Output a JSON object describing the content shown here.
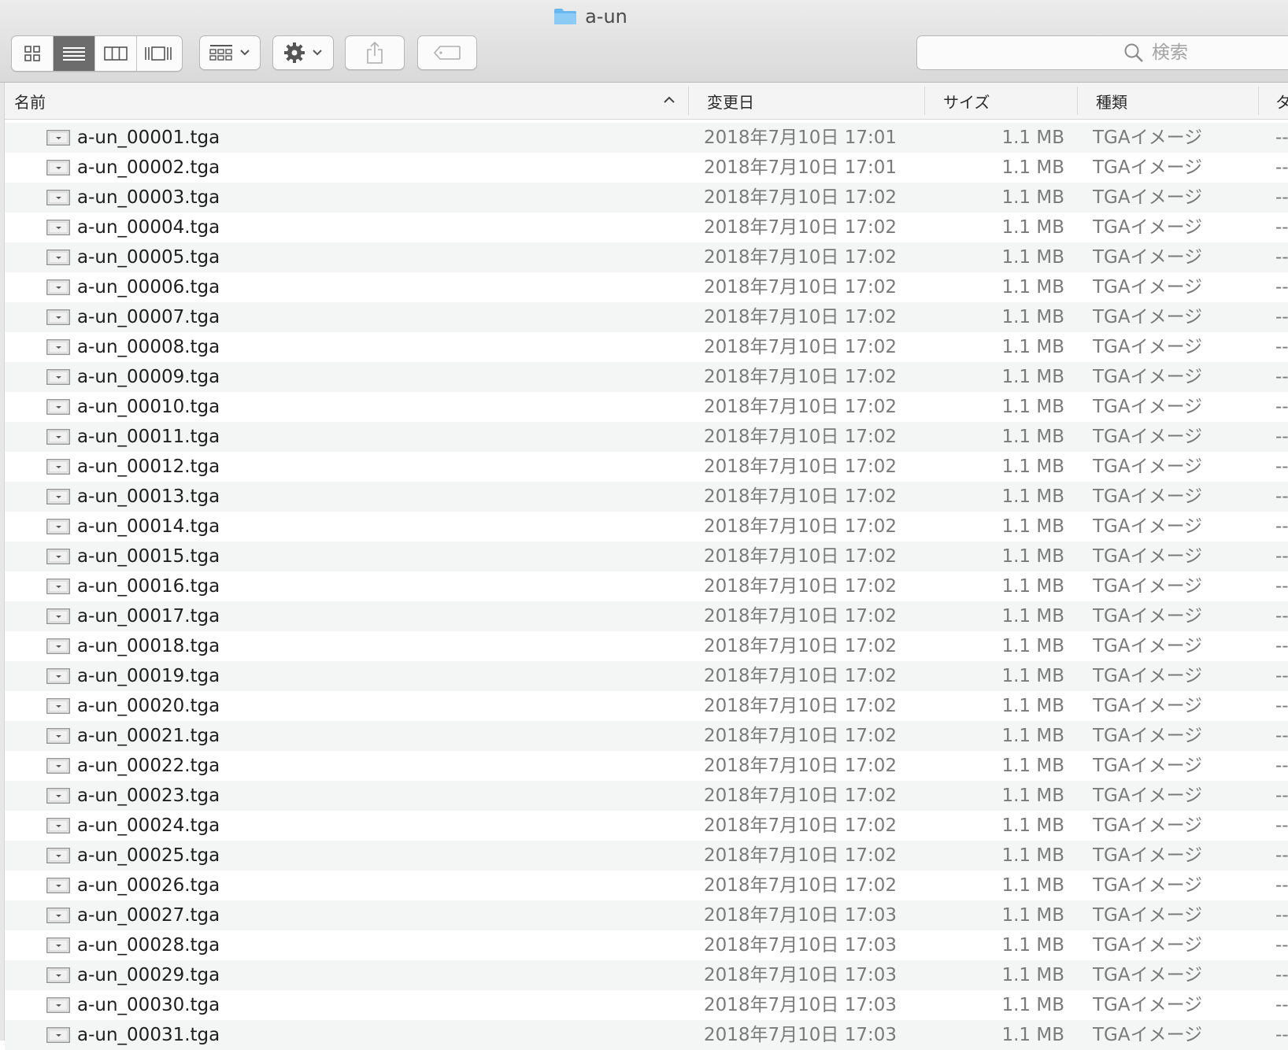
{
  "window": {
    "title": "a-un",
    "folder_icon": "folder-icon",
    "folder_color": "#6ab7ef"
  },
  "toolbar": {
    "view_modes": [
      {
        "name": "icon-view",
        "icon": "grid-icon",
        "active": false
      },
      {
        "name": "list-view",
        "icon": "list-icon",
        "active": true
      },
      {
        "name": "column-view",
        "icon": "columns-icon",
        "active": false
      },
      {
        "name": "cover-flow-view",
        "icon": "cover-flow-icon",
        "active": false
      }
    ],
    "group_icon": "group-icon",
    "action_icon": "gear-icon",
    "share_icon": "share-icon",
    "tag_icon": "tag-icon"
  },
  "search": {
    "placeholder": "検索",
    "value": ""
  },
  "columns": {
    "name": "名前",
    "date": "変更日",
    "size": "サイズ",
    "kind": "種類",
    "tag": "タ"
  },
  "files": [
    {
      "name": "a-un_00001.tga",
      "date": "2018年7月10日 17:01",
      "size": "1.1 MB",
      "kind": "TGAイメージ",
      "tag": "--"
    },
    {
      "name": "a-un_00002.tga",
      "date": "2018年7月10日 17:01",
      "size": "1.1 MB",
      "kind": "TGAイメージ",
      "tag": "--"
    },
    {
      "name": "a-un_00003.tga",
      "date": "2018年7月10日 17:02",
      "size": "1.1 MB",
      "kind": "TGAイメージ",
      "tag": "--"
    },
    {
      "name": "a-un_00004.tga",
      "date": "2018年7月10日 17:02",
      "size": "1.1 MB",
      "kind": "TGAイメージ",
      "tag": "--"
    },
    {
      "name": "a-un_00005.tga",
      "date": "2018年7月10日 17:02",
      "size": "1.1 MB",
      "kind": "TGAイメージ",
      "tag": "--"
    },
    {
      "name": "a-un_00006.tga",
      "date": "2018年7月10日 17:02",
      "size": "1.1 MB",
      "kind": "TGAイメージ",
      "tag": "--"
    },
    {
      "name": "a-un_00007.tga",
      "date": "2018年7月10日 17:02",
      "size": "1.1 MB",
      "kind": "TGAイメージ",
      "tag": "--"
    },
    {
      "name": "a-un_00008.tga",
      "date": "2018年7月10日 17:02",
      "size": "1.1 MB",
      "kind": "TGAイメージ",
      "tag": "--"
    },
    {
      "name": "a-un_00009.tga",
      "date": "2018年7月10日 17:02",
      "size": "1.1 MB",
      "kind": "TGAイメージ",
      "tag": "--"
    },
    {
      "name": "a-un_00010.tga",
      "date": "2018年7月10日 17:02",
      "size": "1.1 MB",
      "kind": "TGAイメージ",
      "tag": "--"
    },
    {
      "name": "a-un_00011.tga",
      "date": "2018年7月10日 17:02",
      "size": "1.1 MB",
      "kind": "TGAイメージ",
      "tag": "--"
    },
    {
      "name": "a-un_00012.tga",
      "date": "2018年7月10日 17:02",
      "size": "1.1 MB",
      "kind": "TGAイメージ",
      "tag": "--"
    },
    {
      "name": "a-un_00013.tga",
      "date": "2018年7月10日 17:02",
      "size": "1.1 MB",
      "kind": "TGAイメージ",
      "tag": "--"
    },
    {
      "name": "a-un_00014.tga",
      "date": "2018年7月10日 17:02",
      "size": "1.1 MB",
      "kind": "TGAイメージ",
      "tag": "--"
    },
    {
      "name": "a-un_00015.tga",
      "date": "2018年7月10日 17:02",
      "size": "1.1 MB",
      "kind": "TGAイメージ",
      "tag": "--"
    },
    {
      "name": "a-un_00016.tga",
      "date": "2018年7月10日 17:02",
      "size": "1.1 MB",
      "kind": "TGAイメージ",
      "tag": "--"
    },
    {
      "name": "a-un_00017.tga",
      "date": "2018年7月10日 17:02",
      "size": "1.1 MB",
      "kind": "TGAイメージ",
      "tag": "--"
    },
    {
      "name": "a-un_00018.tga",
      "date": "2018年7月10日 17:02",
      "size": "1.1 MB",
      "kind": "TGAイメージ",
      "tag": "--"
    },
    {
      "name": "a-un_00019.tga",
      "date": "2018年7月10日 17:02",
      "size": "1.1 MB",
      "kind": "TGAイメージ",
      "tag": "--"
    },
    {
      "name": "a-un_00020.tga",
      "date": "2018年7月10日 17:02",
      "size": "1.1 MB",
      "kind": "TGAイメージ",
      "tag": "--"
    },
    {
      "name": "a-un_00021.tga",
      "date": "2018年7月10日 17:02",
      "size": "1.1 MB",
      "kind": "TGAイメージ",
      "tag": "--"
    },
    {
      "name": "a-un_00022.tga",
      "date": "2018年7月10日 17:02",
      "size": "1.1 MB",
      "kind": "TGAイメージ",
      "tag": "--"
    },
    {
      "name": "a-un_00023.tga",
      "date": "2018年7月10日 17:02",
      "size": "1.1 MB",
      "kind": "TGAイメージ",
      "tag": "--"
    },
    {
      "name": "a-un_00024.tga",
      "date": "2018年7月10日 17:02",
      "size": "1.1 MB",
      "kind": "TGAイメージ",
      "tag": "--"
    },
    {
      "name": "a-un_00025.tga",
      "date": "2018年7月10日 17:02",
      "size": "1.1 MB",
      "kind": "TGAイメージ",
      "tag": "--"
    },
    {
      "name": "a-un_00026.tga",
      "date": "2018年7月10日 17:02",
      "size": "1.1 MB",
      "kind": "TGAイメージ",
      "tag": "--"
    },
    {
      "name": "a-un_00027.tga",
      "date": "2018年7月10日 17:03",
      "size": "1.1 MB",
      "kind": "TGAイメージ",
      "tag": "--"
    },
    {
      "name": "a-un_00028.tga",
      "date": "2018年7月10日 17:03",
      "size": "1.1 MB",
      "kind": "TGAイメージ",
      "tag": "--"
    },
    {
      "name": "a-un_00029.tga",
      "date": "2018年7月10日 17:03",
      "size": "1.1 MB",
      "kind": "TGAイメージ",
      "tag": "--"
    },
    {
      "name": "a-un_00030.tga",
      "date": "2018年7月10日 17:03",
      "size": "1.1 MB",
      "kind": "TGAイメージ",
      "tag": "--"
    },
    {
      "name": "a-un_00031.tga",
      "date": "2018年7月10日 17:03",
      "size": "1.1 MB",
      "kind": "TGAイメージ",
      "tag": "--"
    }
  ]
}
